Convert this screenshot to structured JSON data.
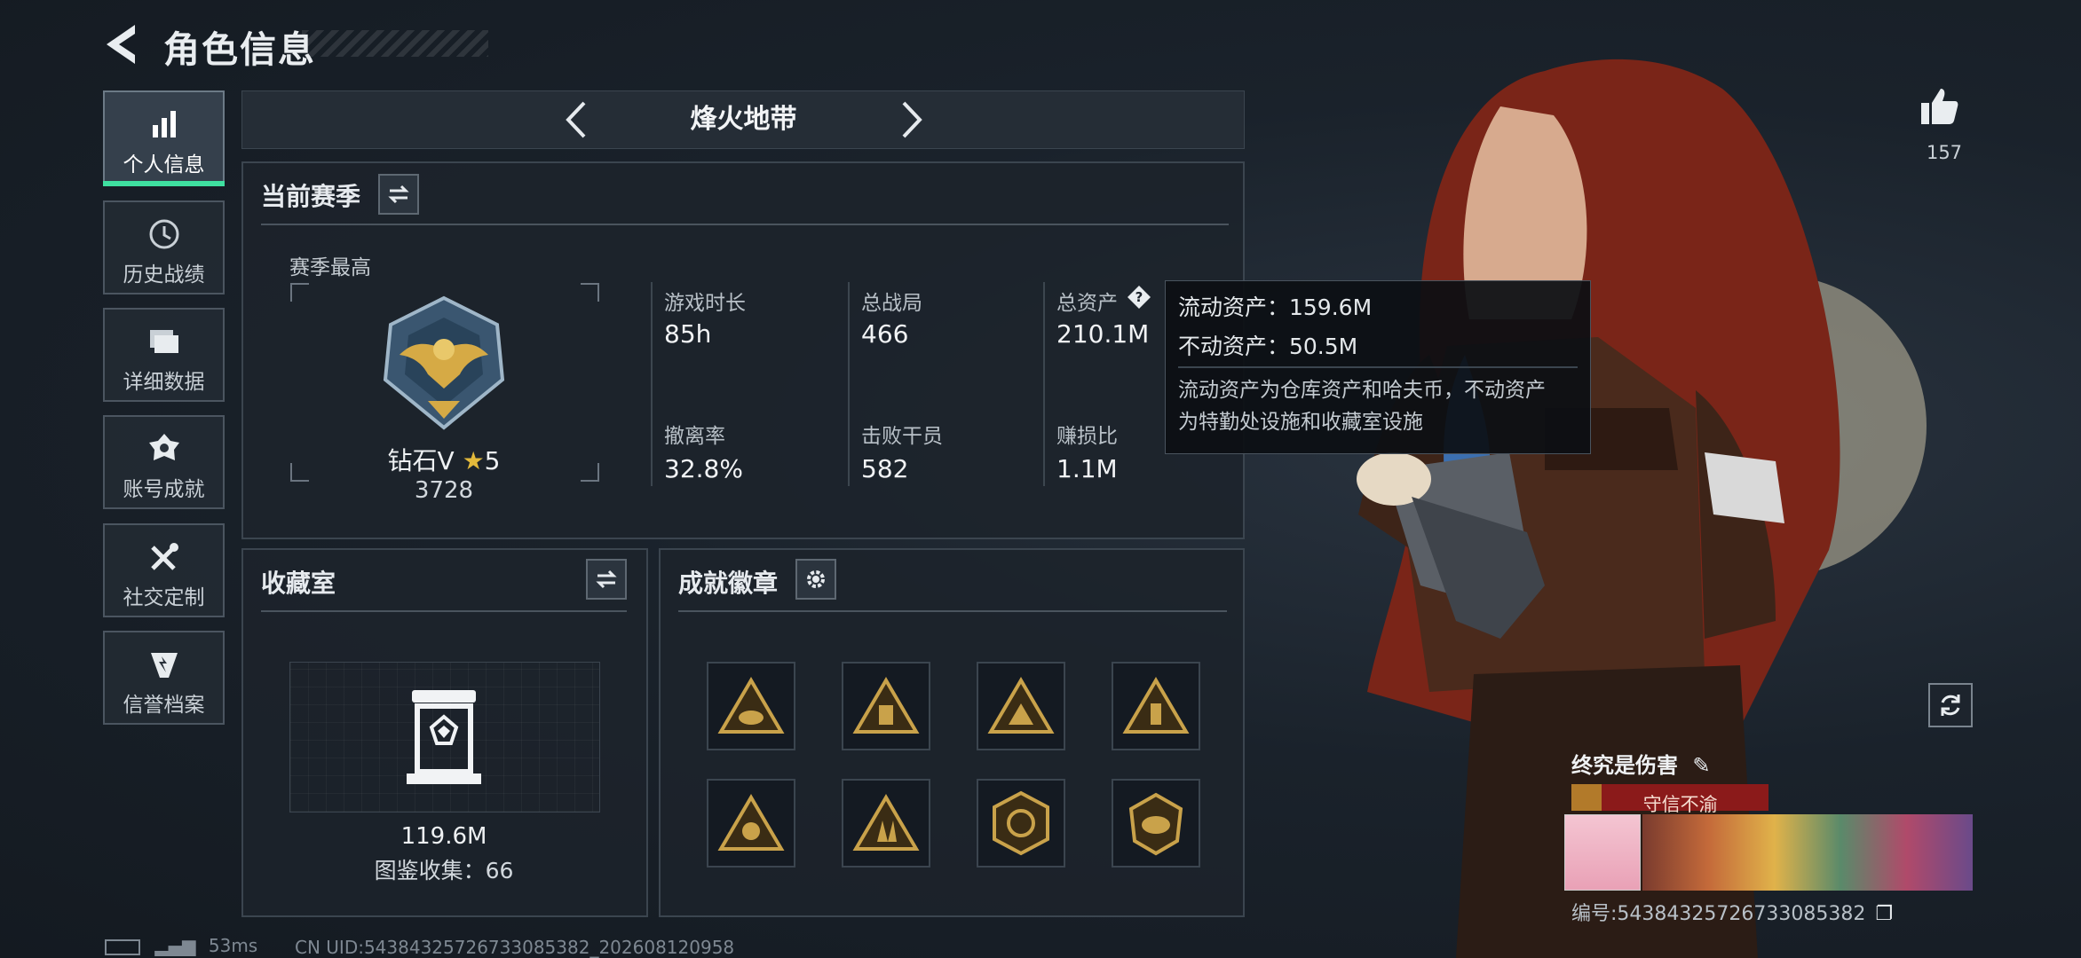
{
  "header": {
    "title": "角色信息"
  },
  "sidebar": {
    "items": [
      {
        "label": "个人信息",
        "icon": "bar-chart-icon",
        "active": true
      },
      {
        "label": "历史战绩",
        "icon": "history-clock-icon",
        "active": false
      },
      {
        "label": "详细数据",
        "icon": "folder-icon",
        "active": false
      },
      {
        "label": "账号成就",
        "icon": "achievement-badge-icon",
        "active": false
      },
      {
        "label": "社交定制",
        "icon": "tools-icon",
        "active": false
      },
      {
        "label": "信誉档案",
        "icon": "credit-shield-icon",
        "active": false
      }
    ]
  },
  "mode": {
    "name": "烽火地带"
  },
  "season": {
    "title": "当前赛季",
    "best_label": "赛季最高",
    "rank_name": "钻石V",
    "rank_stars": "5",
    "rank_score": "3728",
    "stats": [
      {
        "label": "游戏时长",
        "value": "85h"
      },
      {
        "label": "总战局",
        "value": "466"
      },
      {
        "label": "总资产",
        "value": "210.1M"
      },
      {
        "label": "撤离率",
        "value": "32.8%"
      },
      {
        "label": "击败干员",
        "value": "582"
      },
      {
        "label": "赚损比",
        "value": "1.1M"
      }
    ]
  },
  "tooltip": {
    "line1": "流动资产：159.6M",
    "line2": "不动资产：50.5M",
    "desc1": "流动资产为仓库资产和哈夫币，不动资产",
    "desc2": "为特勤处设施和收藏室设施"
  },
  "collection": {
    "title": "收藏室",
    "value": "119.6M",
    "count_text": "图鉴收集：66"
  },
  "badges": {
    "title": "成就徽章",
    "items": [
      "badge-1",
      "badge-2",
      "badge-3",
      "badge-4",
      "badge-5",
      "badge-6",
      "badge-7",
      "badge-8"
    ]
  },
  "profile": {
    "likes": "157",
    "name": "终究是伤害",
    "title_tag": "守信不渝",
    "uid_line": "编号:54384325726733085382"
  },
  "footer": {
    "ping": "53ms",
    "uid": "CN UID:54384325726733085382_202608120958"
  },
  "colors": {
    "accent": "#3fe0a0",
    "gold": "#c9a24a",
    "title_red": "#8b1a1a"
  }
}
